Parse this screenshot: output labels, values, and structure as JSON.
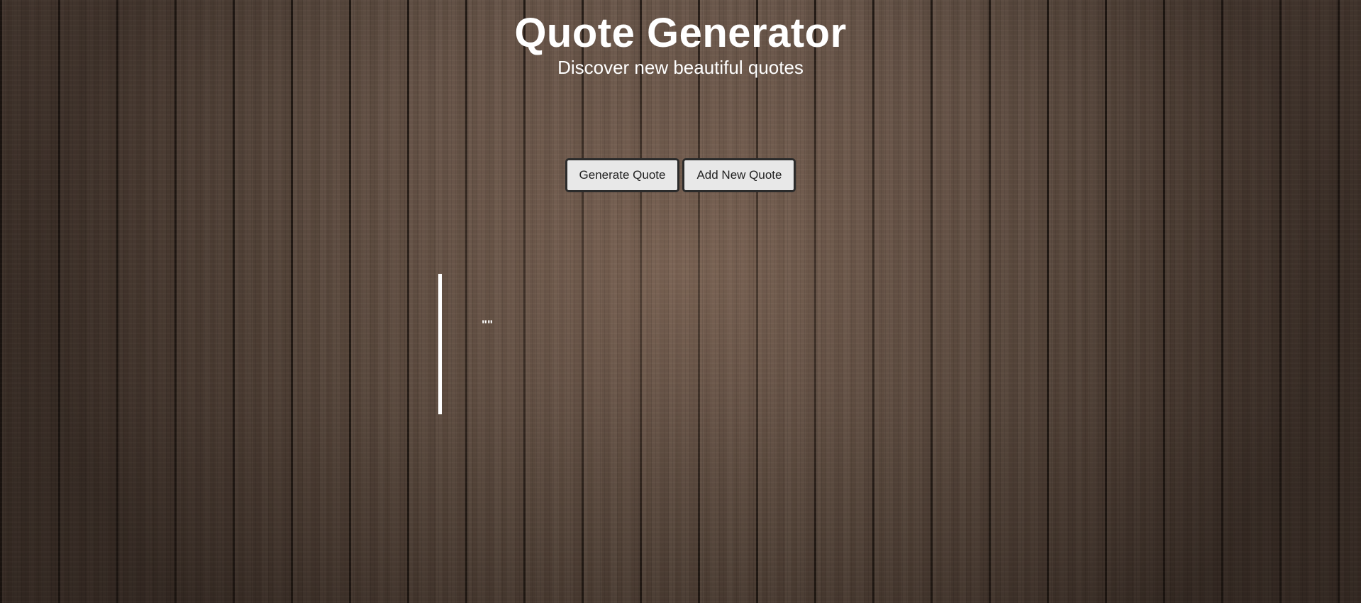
{
  "header": {
    "title": "Quote Generator",
    "subtitle": "Discover new beautiful quotes"
  },
  "controls": {
    "generate_label": "Generate Quote",
    "add_label": "Add New Quote"
  },
  "quote": {
    "text": "\"\""
  },
  "colors": {
    "text": "#ffffff",
    "button_bg": "#e8e8e8",
    "button_border": "#2b2b2b",
    "quote_border": "#ffffff"
  }
}
